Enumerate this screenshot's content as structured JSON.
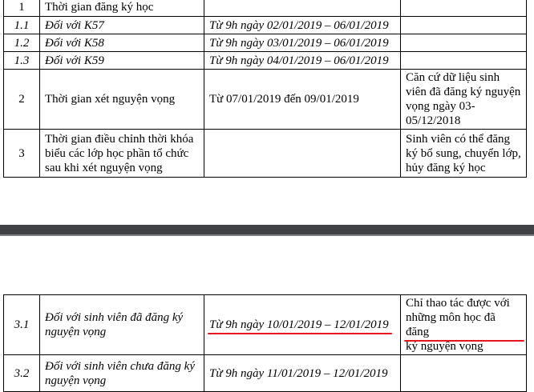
{
  "table_top": {
    "rows": [
      {
        "num": "1",
        "label": "Thời gian đăng ký học",
        "time": "",
        "note": ""
      },
      {
        "num": "1.1",
        "label": "Đối với K57",
        "time": "Từ 9h ngày 02/01/2019 – 06/01/2019",
        "note": ""
      },
      {
        "num": "1.2",
        "label": "Đối với K58",
        "time_prefix": "Từ 9h ngày ",
        "time_highlight": "03/01/2019 – 06/01/2019",
        "note": ""
      },
      {
        "num": "1.3",
        "label": "Đối với K59",
        "time": "Từ 9h ngày 04/01/2019 – 06/01/2019",
        "note": ""
      },
      {
        "num": "2",
        "label": "Thời gian xét nguyện vọng",
        "time": "Từ 07/01/2019 đến 09/01/2019",
        "note": "Căn cứ dữ liệu sinh viên đã đăng ký nguyện vọng ngày 03-05/12/2018"
      },
      {
        "num": "3",
        "label": "Thời gian điều chỉnh thời khóa biểu các lớp học phần tổ chức sau khi xét nguyện vọng",
        "time": "",
        "note": "Sinh viên có thể đăng ký bổ sung, chuyển lớp, hủy đăng ký học"
      }
    ]
  },
  "table_bottom": {
    "rows": [
      {
        "num": "3.1",
        "label": "Đối với sinh viên đã đăng ký nguyện vọng",
        "time_highlight": "Từ 9h ngày 10/01/2019 – 12/01/2019",
        "note_prefix": "Chỉ thao tác được với ",
        "note_highlight": "những môn học đã đăng",
        "note_suffix": "ký nguyện vọng"
      },
      {
        "num": "3.2",
        "label": "Đối với sinh viên chưa đăng ký nguyện vọng",
        "time": "Từ 9h ngày 11/01/2019 – 12/01/2019",
        "note": ""
      }
    ]
  },
  "colors": {
    "underline": "#e8161c",
    "page_break_band": "#3f4144"
  }
}
